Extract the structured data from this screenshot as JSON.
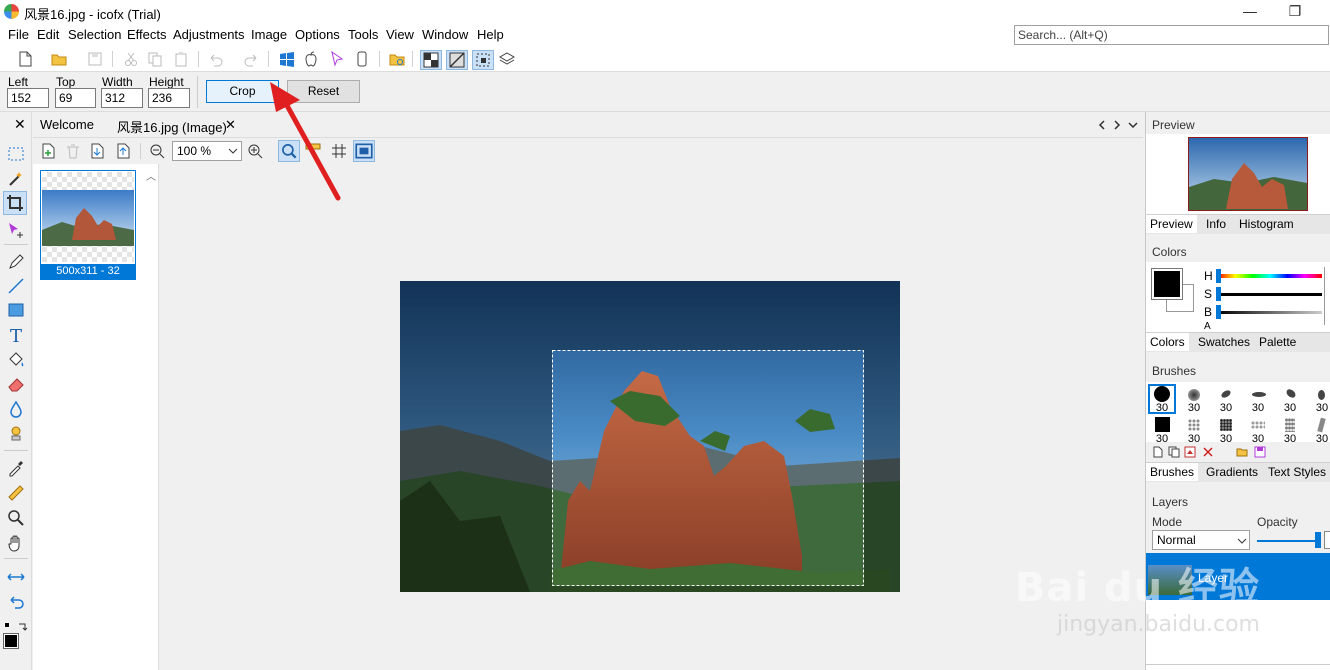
{
  "window": {
    "title": "风景16.jpg - icofx (Trial)",
    "minimize_glyph": "—",
    "restore_glyph": "❐"
  },
  "menu": [
    "File",
    "Edit",
    "Selection",
    "Effects",
    "Adjustments",
    "Image",
    "Options",
    "Tools",
    "View",
    "Window",
    "Help"
  ],
  "search": {
    "placeholder": "Search... (Alt+Q)"
  },
  "crop_bar": {
    "left_label": "Left",
    "left_value": "152",
    "top_label": "Top",
    "top_value": "69",
    "width_label": "Width",
    "width_value": "312",
    "height_label": "Height",
    "height_value": "236",
    "crop_button": "Crop",
    "reset_button": "Reset"
  },
  "tabs": [
    {
      "label": "Welcome"
    },
    {
      "label": "风景16.jpg (Image)",
      "close": "✕"
    }
  ],
  "doc_toolbar": {
    "zoom": "100 %"
  },
  "thumbnail": {
    "caption": "500x311 - 32"
  },
  "right_panel": {
    "preview_title": "Preview",
    "preview_tabs": [
      "Preview",
      "Info",
      "Histogram"
    ],
    "colors_title": "Colors",
    "hsb_labels": [
      "H",
      "S",
      "B",
      "A"
    ],
    "colors_tabs": [
      "Colors",
      "Swatches",
      "Palette"
    ],
    "brushes_title": "Brushes",
    "brush_sizes": [
      "30",
      "30",
      "30",
      "30",
      "30",
      "30",
      "30",
      "30",
      "30",
      "30",
      "30",
      "30"
    ],
    "brushes_tabs": [
      "Brushes",
      "Gradients",
      "Text Styles"
    ],
    "layers_title": "Layers",
    "mode_label": "Mode",
    "mode_value": "Normal",
    "opacity_label": "Opacity",
    "layer_name": "Layer"
  },
  "watermark": {
    "main": "Bai du 经验",
    "sub": "jingyan.baidu.com"
  },
  "colors": {
    "accent": "#0078d7",
    "selection_blue": "#c9e0f7",
    "arrow": "#e02020"
  }
}
